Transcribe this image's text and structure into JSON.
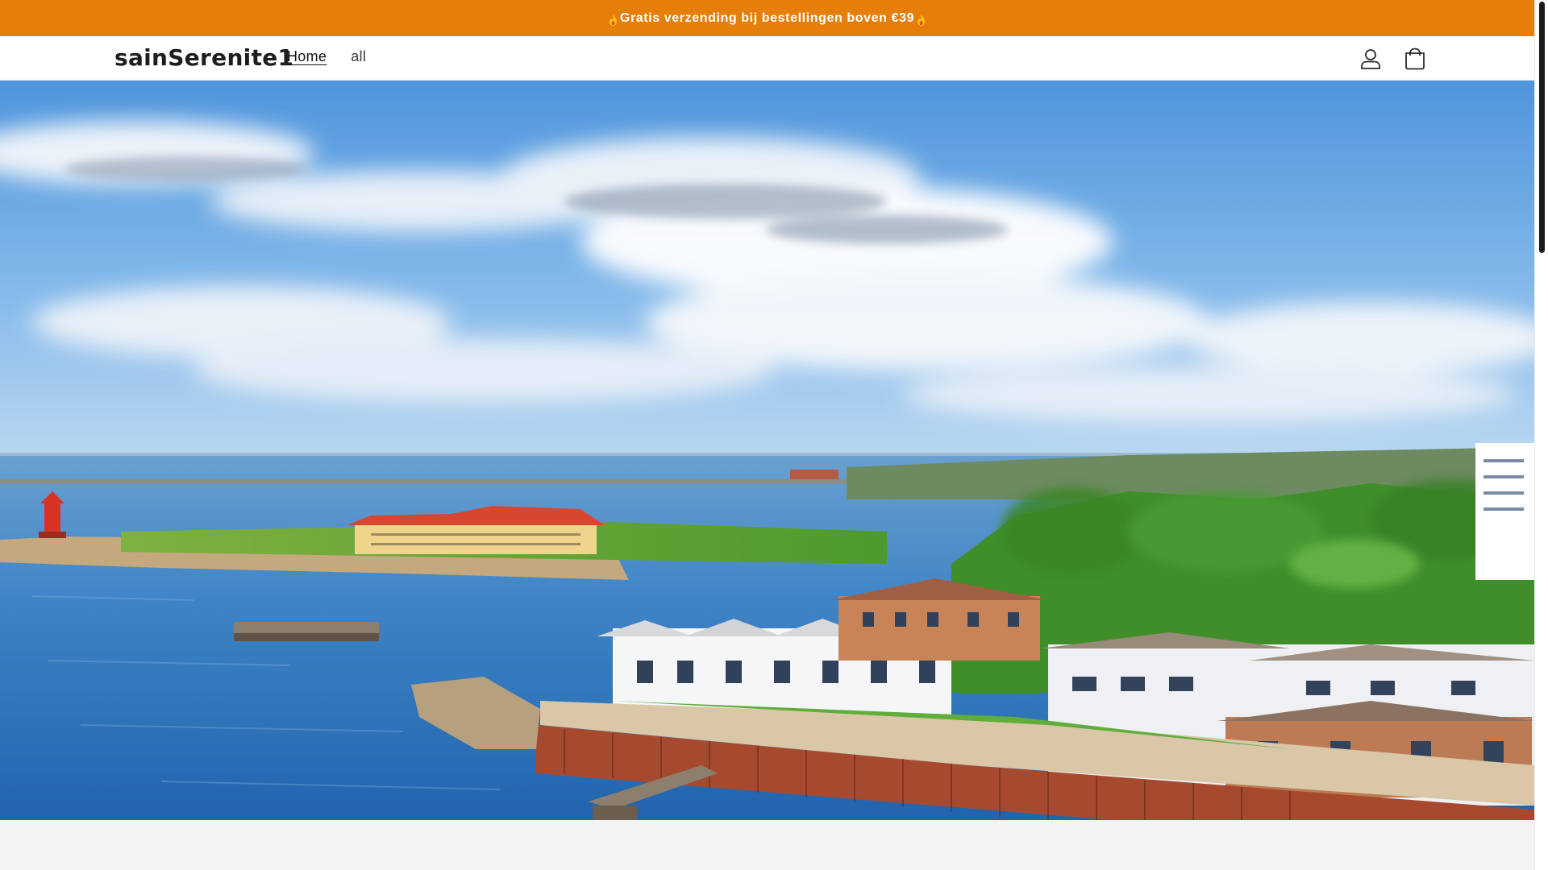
{
  "announcement": {
    "text": "Gratis verzending bij bestellingen boven €39",
    "background": "#e67e0a",
    "icon": "flame-icon"
  },
  "header": {
    "logo": "sainSerenite1",
    "nav": [
      {
        "label": "Home",
        "active": true
      },
      {
        "label": "all",
        "active": false
      }
    ],
    "icons": [
      "account-icon",
      "cart-icon"
    ]
  },
  "hero": {
    "image": "coastal-harbour-town-image"
  }
}
